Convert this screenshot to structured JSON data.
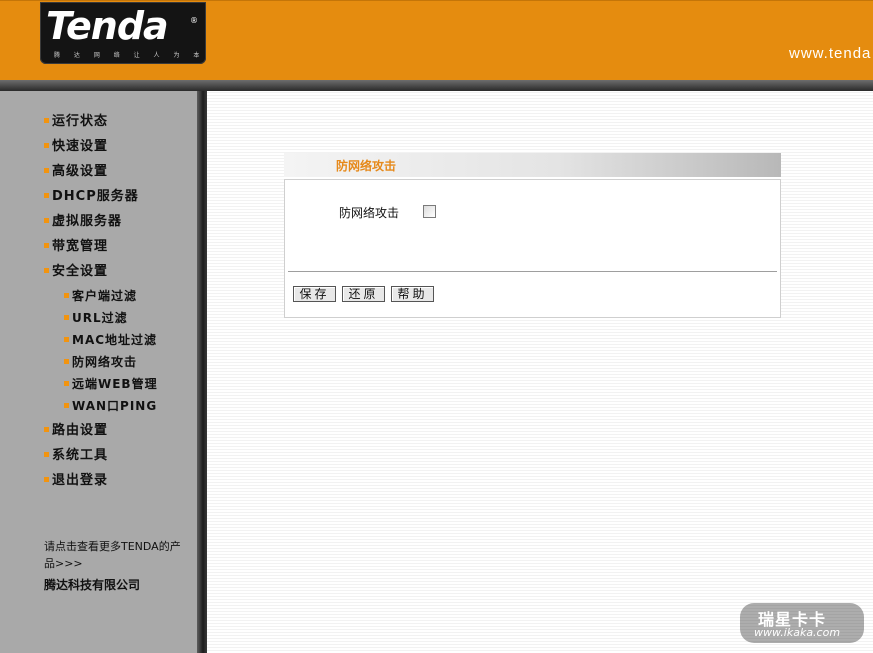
{
  "header": {
    "logo_text": "Tenda",
    "logo_mark": "®",
    "logo_slogan": "腾 达 网 络 让 人 为 本",
    "url": "www.tenda",
    "accent_color": "#e58c0f"
  },
  "sidebar": {
    "items": [
      {
        "label": "运行状态"
      },
      {
        "label": "快速设置"
      },
      {
        "label": "高级设置"
      },
      {
        "label": "DHCP服务器"
      },
      {
        "label": "虚拟服务器"
      },
      {
        "label": "带宽管理"
      },
      {
        "label": "安全设置"
      }
    ],
    "sub_items": [
      {
        "label": "客户端过滤"
      },
      {
        "label": "URL过滤"
      },
      {
        "label": "MAC地址过滤"
      },
      {
        "label": "防网络攻击"
      },
      {
        "label": "远端WEB管理"
      },
      {
        "label": "WAN口PING"
      }
    ],
    "items_after": [
      {
        "label": "路由设置"
      },
      {
        "label": "系统工具"
      },
      {
        "label": "退出登录"
      }
    ],
    "more_link": "请点击查看更多TENDA的产品>>>",
    "company": "腾达科技有限公司"
  },
  "main": {
    "panel_title": "防网络攻击",
    "field_label": "防网络攻击",
    "checkbox_checked": false,
    "buttons": {
      "save": "保存",
      "restore": "还原",
      "help": "帮助"
    }
  },
  "watermark": {
    "title": "瑞星卡卡",
    "url": "www.ikaka.com"
  }
}
